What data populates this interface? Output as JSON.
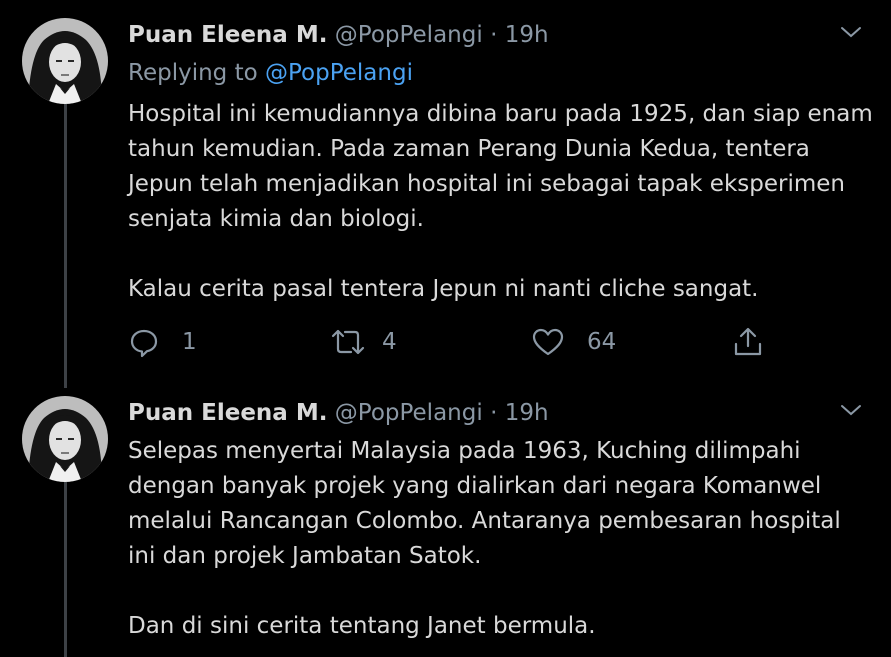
{
  "tweets": [
    {
      "name": "Puan Eleena M.",
      "handle": "@PopPelangi",
      "separator": "·",
      "time": "19h",
      "replying_prefix": "Replying to",
      "replying_to": "@PopPelangi",
      "paragraphs": [
        "Hospital ini kemudiannya dibina baru pada 1925, dan siap enam tahun kemudian. Pada zaman Perang Dunia Kedua, tentera Jepun telah menjadikan hospital ini sebagai tapak eksperimen senjata kimia dan biologi.",
        "Kalau cerita pasal tentera Jepun ni nanti cliche sangat."
      ],
      "reply_count": "1",
      "retweet_count": "4",
      "like_count": "64"
    },
    {
      "name": "Puan Eleena M.",
      "handle": "@PopPelangi",
      "separator": "·",
      "time": "19h",
      "paragraphs": [
        "Selepas menyertai Malaysia pada 1963, Kuching dilimpahi dengan banyak projek yang dialirkan dari negara Komanwel melalui Rancangan Colombo. Antaranya pembesaran hospital ini dan projek Jambatan Satok.",
        "Dan di sini cerita tentang Janet bermula."
      ]
    }
  ],
  "icons": [
    "reply-icon",
    "retweet-icon",
    "like-icon",
    "share-icon",
    "chevron-down-icon"
  ],
  "colors": {
    "background": "#000000",
    "text": "#d9d9d9",
    "secondary": "#8b98a5",
    "link": "#4ba2f2",
    "thread_line": "#3d4146"
  }
}
